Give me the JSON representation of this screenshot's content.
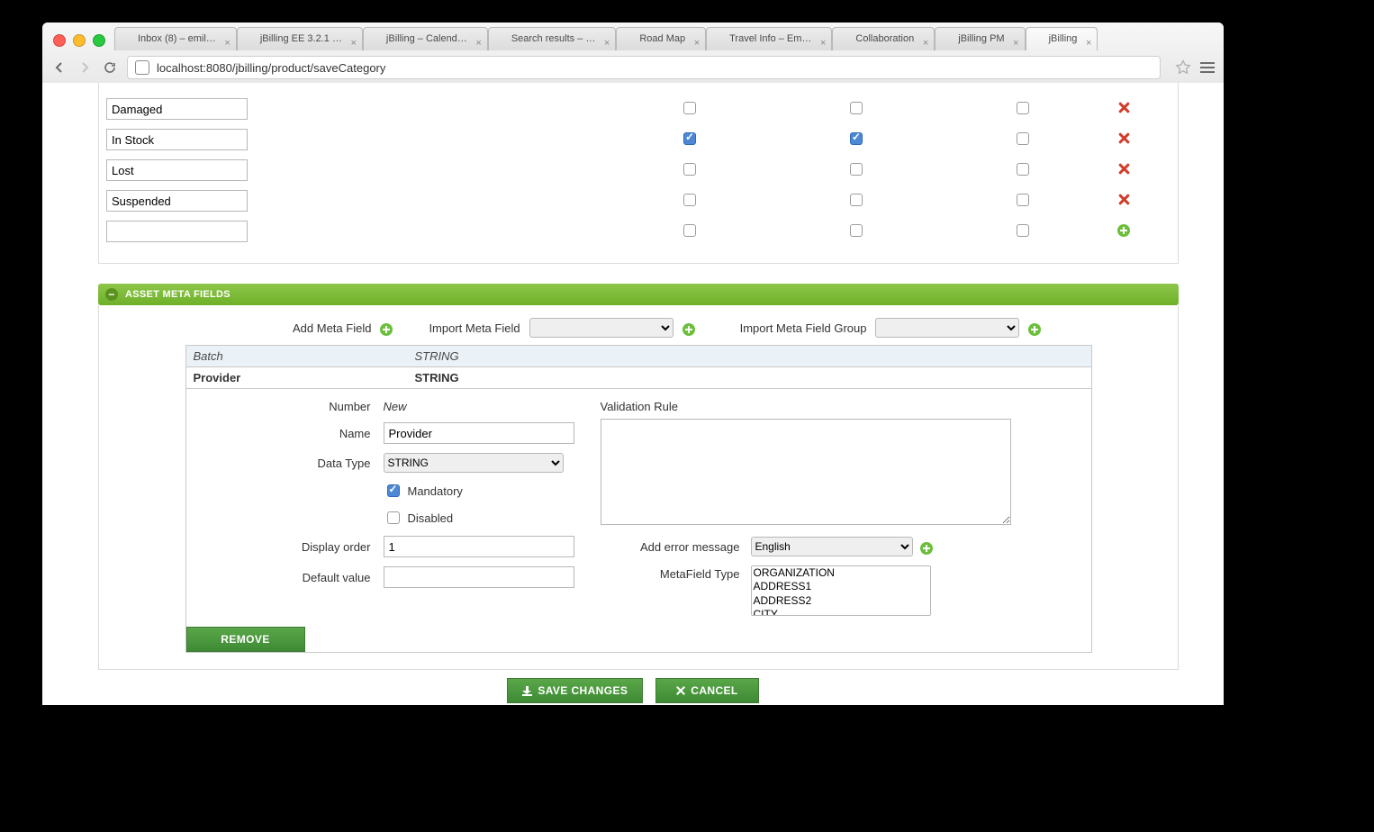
{
  "browser": {
    "url": "localhost:8080/jbilling/product/saveCategory",
    "tabs": [
      {
        "label": "Inbox (8) – emil…"
      },
      {
        "label": "jBilling EE 3.2.1 …"
      },
      {
        "label": "jBilling – Calend…"
      },
      {
        "label": "Search results – …"
      },
      {
        "label": "Road Map"
      },
      {
        "label": "Travel Info – Em…"
      },
      {
        "label": "Collaboration"
      },
      {
        "label": "jBilling PM"
      },
      {
        "label": "jBilling"
      }
    ],
    "active_tab": 8
  },
  "status_rows": [
    {
      "name": "Damaged",
      "c1": false,
      "c2": false,
      "c3": false,
      "act": "delete"
    },
    {
      "name": "In Stock",
      "c1": true,
      "c2": true,
      "c3": false,
      "act": "delete"
    },
    {
      "name": "Lost",
      "c1": false,
      "c2": false,
      "c3": false,
      "act": "delete"
    },
    {
      "name": "Suspended",
      "c1": false,
      "c2": false,
      "c3": false,
      "act": "delete"
    },
    {
      "name": "",
      "c1": false,
      "c2": false,
      "c3": false,
      "act": "add"
    }
  ],
  "meta_section": {
    "title": "ASSET META FIELDS",
    "add_label": "Add Meta Field",
    "import_label": "Import Meta Field",
    "import_group_label": "Import Meta Field Group",
    "rows": [
      {
        "name": "Batch",
        "type": "STRING",
        "kind": "batch"
      },
      {
        "name": "Provider",
        "type": "STRING",
        "kind": "prov"
      }
    ],
    "detail": {
      "number_label": "Number",
      "number_value": "New",
      "name_label": "Name",
      "name_value": "Provider",
      "datatype_label": "Data Type",
      "datatype_value": "STRING",
      "mandatory_label": "Mandatory",
      "mandatory_checked": true,
      "disabled_label": "Disabled",
      "disabled_checked": false,
      "display_order_label": "Display order",
      "display_order_value": "1",
      "default_label": "Default value",
      "default_value": "",
      "vrule_label": "Validation Rule",
      "err_label": "Add error message",
      "err_lang": "English",
      "type_label": "MetaField Type",
      "type_options": [
        "ORGANIZATION",
        "ADDRESS1",
        "ADDRESS2",
        "CITY"
      ]
    },
    "remove_label": "REMOVE"
  },
  "bottom": {
    "save": "SAVE CHANGES",
    "cancel": "CANCEL"
  }
}
